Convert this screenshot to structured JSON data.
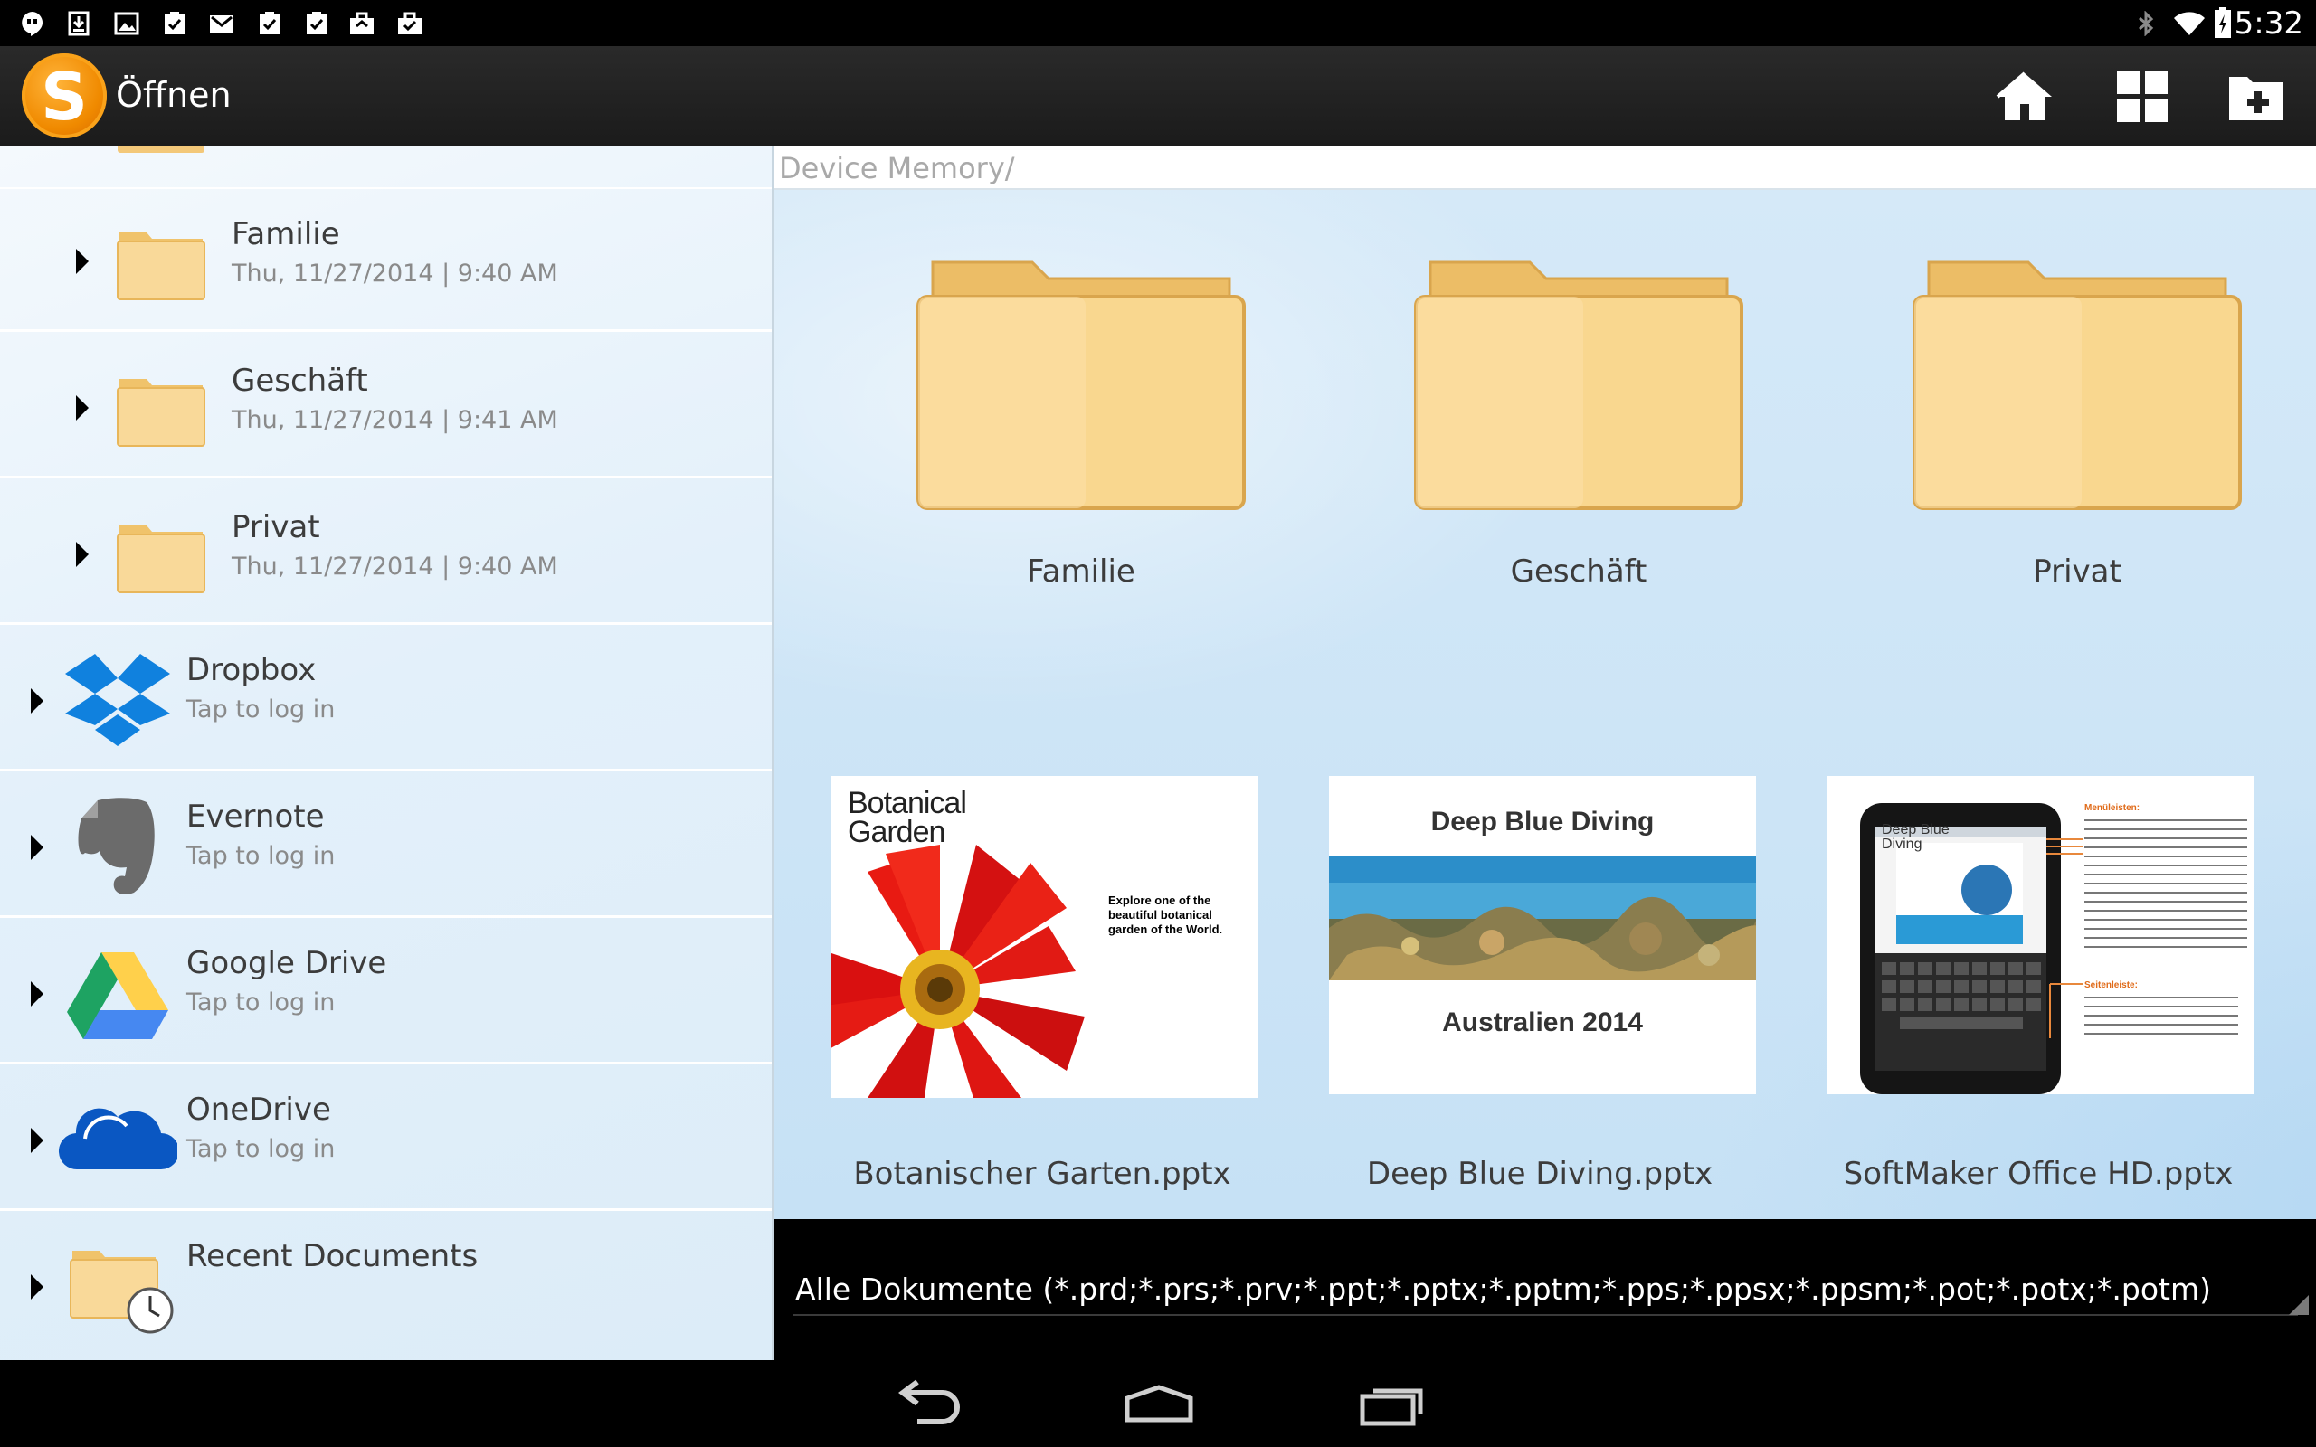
{
  "status_bar": {
    "time": "5:32",
    "notification_icons": [
      "hangouts-icon",
      "download-icon",
      "image-icon",
      "task-done-icon",
      "gmail-icon",
      "task-done-icon",
      "task-done-icon",
      "briefcase-icon",
      "briefcase-check-icon"
    ],
    "system_icons": [
      "bluetooth-icon",
      "wifi-icon",
      "battery-charging-icon"
    ]
  },
  "action_bar": {
    "logo_letter": "S",
    "title": "Öffnen",
    "buttons": [
      "home-icon",
      "grid-view-icon",
      "new-folder-icon"
    ]
  },
  "left_panel": {
    "folders": [
      {
        "name": "Familie",
        "date": "Thu, 11/27/2014 | 9:40 AM"
      },
      {
        "name": "Geschäft",
        "date": "Thu, 11/27/2014 | 9:41 AM"
      },
      {
        "name": "Privat",
        "date": "Thu, 11/27/2014 | 9:40 AM"
      }
    ],
    "services": [
      {
        "name": "Dropbox",
        "sub": "Tap to log in",
        "icon": "dropbox-icon"
      },
      {
        "name": "Evernote",
        "sub": "Tap to log in",
        "icon": "evernote-icon"
      },
      {
        "name": "Google Drive",
        "sub": "Tap to log in",
        "icon": "google-drive-icon"
      },
      {
        "name": "OneDrive",
        "sub": "Tap to log in",
        "icon": "onedrive-icon"
      }
    ],
    "recent": {
      "name": "Recent Documents",
      "icon": "recent-documents-icon"
    }
  },
  "path": "Device Memory/",
  "grid": {
    "folders": [
      {
        "label": "Familie"
      },
      {
        "label": "Geschäft"
      },
      {
        "label": "Privat"
      }
    ],
    "files": [
      {
        "label": "Botanischer Garten.pptx",
        "thumb_title_line1": "Botanical",
        "thumb_title_line2": "Garden",
        "thumb_caption_1": "Explore one of the",
        "thumb_caption_2": "beautiful botanical",
        "thumb_caption_3": "garden of the World."
      },
      {
        "label": "Deep Blue Diving.pptx",
        "thumb_title": "Deep Blue Diving",
        "thumb_subtitle": "Australien 2014"
      },
      {
        "label": "SoftMaker Office HD.pptx",
        "thumb_heading_1": "Menüleisten:",
        "thumb_heading_2": "Seitenleiste:",
        "thumb_screen_title_1": "Deep Blue",
        "thumb_screen_title_2": "Diving"
      }
    ]
  },
  "filter": {
    "text": "Alle Dokumente (*.prd;*.prs;*.prv;*.ppt;*.pptx;*.pptm;*.pps;*.ppsx;*.ppsm;*.pot;*.potx;*.potm)"
  },
  "nav_bar": {
    "buttons": [
      "back-icon",
      "home-nav-icon",
      "recents-icon"
    ]
  },
  "colors": {
    "folder_fill": "#f7d48f",
    "accent_orange": "#f08a00",
    "dropbox_blue": "#1081de",
    "onedrive_blue": "#0a57c2"
  }
}
